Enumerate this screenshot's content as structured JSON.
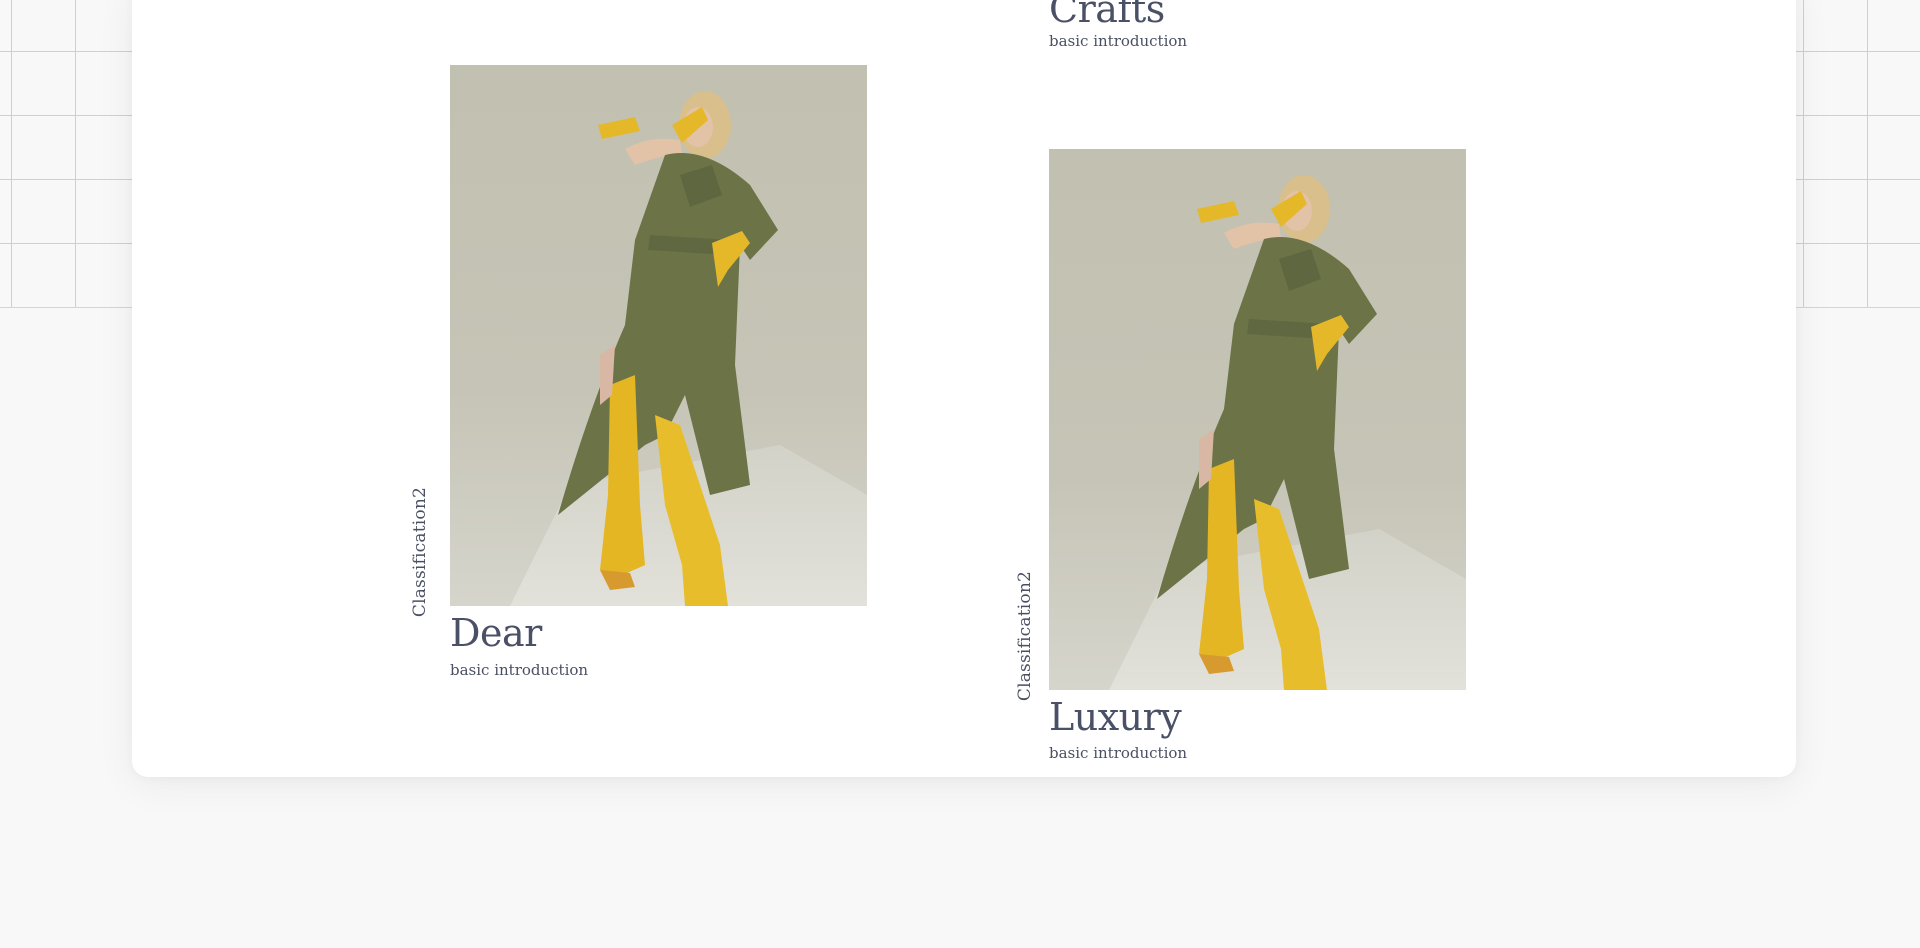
{
  "colors": {
    "page_background": "#f8f8f8",
    "card_background": "#ffffff",
    "text": "#4a5065",
    "photo_background": "#c1bfaf",
    "dress": "#6c7448",
    "boots": "#e5bb29"
  },
  "products": [
    {
      "title": "Crafts",
      "intro": "basic introduction"
    },
    {
      "title": "Dear",
      "intro": "basic introduction",
      "classification": "Classification2",
      "image_icon": "fashion-model-photo"
    },
    {
      "title": "Luxury",
      "intro": "basic introduction",
      "classification": "Classification2",
      "image_icon": "fashion-model-photo"
    }
  ]
}
